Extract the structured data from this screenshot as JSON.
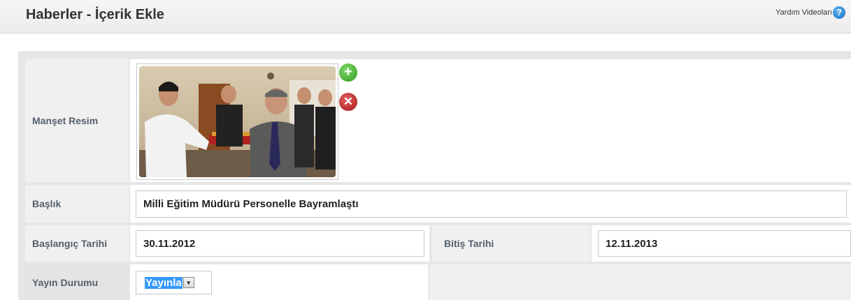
{
  "header": {
    "title": "Haberler - İçerik Ekle",
    "help_label": "Yardım Videoları",
    "help_icon": "question-circle-icon"
  },
  "form": {
    "headline_image_label": "Manşet Resim",
    "add_image_icon": "plus-circle-icon",
    "remove_image_icon": "x-circle-icon",
    "title_label": "Başlık",
    "title_value": "Milli Eğitim Müdürü Personelle Bayramlaştı",
    "start_date_label": "Başlangıç Tarihi",
    "start_date_value": "30.11.2012",
    "end_date_label": "Bitiş Tarihi",
    "end_date_value": "12.11.2013",
    "status_label": "Yayın Durumu",
    "status_value": "Yayınla"
  },
  "colors": {
    "label_text": "#555f6b",
    "label_bg": "#f0f0f0",
    "panel_bg": "#e6e6e6",
    "selection": "#3399ff"
  }
}
